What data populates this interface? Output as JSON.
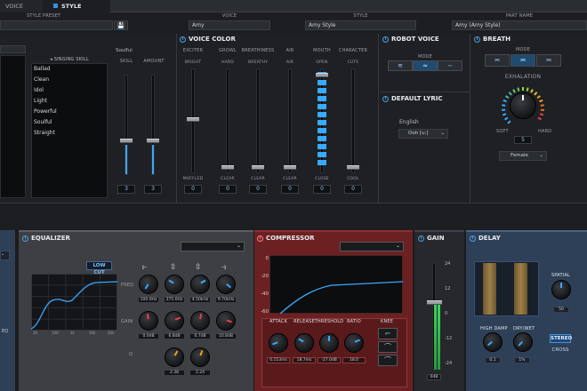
{
  "tabs": {
    "voice": "VOICE",
    "style": "STYLE"
  },
  "top": {
    "style_preset": "STYLE PRESET",
    "voice_h": "VOICE",
    "voice": "Amy",
    "style_h": "STYLE",
    "style": "Amy Style",
    "part_h": "PART NAME",
    "part": "Amy (Amy Style)"
  },
  "skill": {
    "header": "SINGING SKILL",
    "items": [
      "Ballad",
      "Clean",
      "Idol",
      "Light",
      "Powerful",
      "Soulful",
      "Straight"
    ],
    "soulful": "Soulful",
    "skill_l": "SKILL",
    "amount_l": "AMOUNT",
    "skill_v": "3",
    "amount_v": "3"
  },
  "vc": {
    "title": "VOICE COLOR",
    "cols": [
      {
        "n": "EXCITER",
        "top": "BRIGHT",
        "bot": "MUFFLED",
        "v": "0"
      },
      {
        "n": "GROWL",
        "top": "HARD",
        "bot": "CLEAR",
        "v": "0"
      },
      {
        "n": "BREATHINESS",
        "top": "BREATHY",
        "bot": "CLEAR",
        "v": "0"
      },
      {
        "n": "AIR",
        "top": "AIR",
        "bot": "CLEAR",
        "v": "0"
      },
      {
        "n": "MOUTH",
        "top": "OPEN",
        "bot": "CLOSE",
        "v": "0"
      },
      {
        "n": "CHARACTER",
        "top": "CUTE",
        "bot": "COOL",
        "v": "0"
      }
    ]
  },
  "robot": {
    "title": "ROBOT VOICE",
    "mode": "MODE"
  },
  "lyric": {
    "title": "DEFAULT LYRIC",
    "lang": "English",
    "value": "Ooh [u:]"
  },
  "breath": {
    "title": "BREATH",
    "mode": "MODE",
    "exh": "EXHALATION",
    "soft": "SOFT",
    "hard": "HARD",
    "value": "5",
    "gender": "Female"
  },
  "eq": {
    "title": "EQUALIZER",
    "lowcut": "LOW CUT",
    "freq": "FREQ",
    "gain": "GAIN",
    "q": "Q",
    "ticks": [
      "30",
      "100",
      "1k",
      "10k",
      "20k"
    ],
    "freqs": [
      "100.0Hz",
      "375.0Hz",
      "4.50kHz",
      "9.70kHz"
    ],
    "gains": [
      "0.0dB",
      "6.8dB",
      "0.7dB",
      "10.8dB"
    ],
    "qs": [
      "2.38",
      "2.24"
    ],
    "colors": {
      "freq": "#3aa8ff",
      "gain": "#e8404a",
      "q": "#f0a020"
    }
  },
  "eqleft": {
    "label": "EQ"
  },
  "comp": {
    "title": "COMPRESSOR",
    "ticks": [
      "0",
      "-20",
      "-40",
      "-60"
    ],
    "knobs": [
      "ATTACK",
      "RELEASE",
      "THRESHOLD",
      "RATIO"
    ],
    "vals": [
      "0.153ms",
      "18.7ms",
      "-27.0dB",
      "18.0"
    ],
    "knee": "KNEE"
  },
  "gain": {
    "title": "GAIN",
    "ticks": [
      "24",
      "12",
      "0",
      "-12",
      "-24"
    ],
    "value": "0dB"
  },
  "delay": {
    "title": "DELAY",
    "spatial": "SPATIAL",
    "spatial_v": "50",
    "hd": "HIGH DAMP",
    "dw": "DRY/WET",
    "hd_v": "0.1",
    "dw_v": "1%",
    "stereo": "STEREO",
    "cross": "CROSS"
  }
}
